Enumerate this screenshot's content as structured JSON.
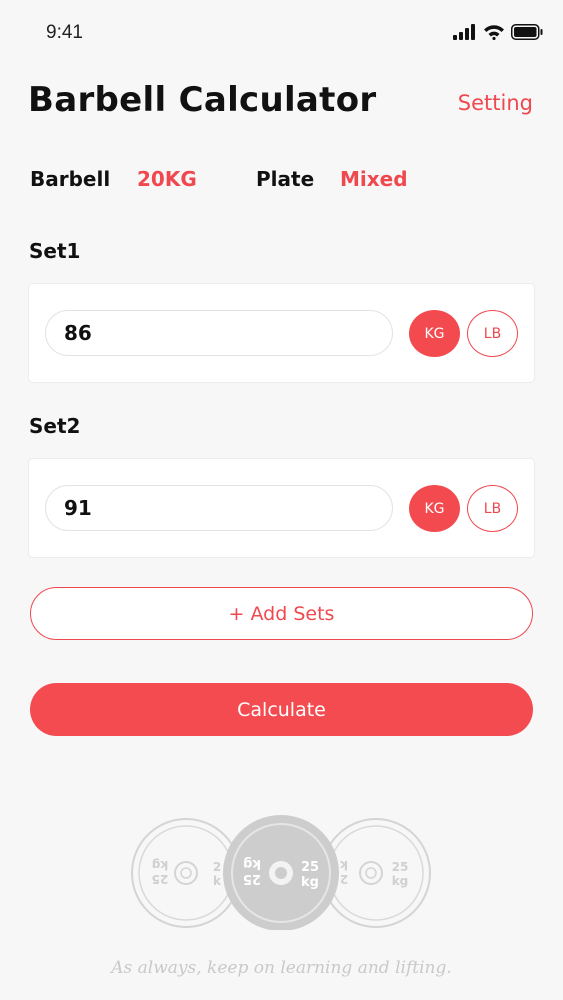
{
  "status_bar": {
    "time": "9:41",
    "icons": [
      "cellular-signal-icon",
      "wifi-icon",
      "battery-icon"
    ]
  },
  "header": {
    "title": "Barbell Calculator",
    "setting_label": "Setting"
  },
  "config": {
    "barbell_label": "Barbell",
    "barbell_value": "20KG",
    "plate_label": "Plate",
    "plate_value": "Mixed"
  },
  "sets": [
    {
      "label": "Set1",
      "value": "86",
      "units": [
        "KG",
        "LB"
      ],
      "selected_unit": "KG"
    },
    {
      "label": "Set2",
      "value": "91",
      "units": [
        "KG",
        "LB"
      ],
      "selected_unit": "KG"
    }
  ],
  "actions": {
    "add_sets_label": "+ Add Sets",
    "calculate_label": "Calculate"
  },
  "illustration": {
    "plate_text_number": "25",
    "plate_text_unit": "kg",
    "plate_partial_number": "2",
    "plate_partial_unit": "k"
  },
  "footer": {
    "motto": "As always, keep on learning and lifting."
  },
  "colors": {
    "accent": "#f0484f",
    "accent_fill": "#f44b51",
    "background": "#f7f7f7"
  }
}
